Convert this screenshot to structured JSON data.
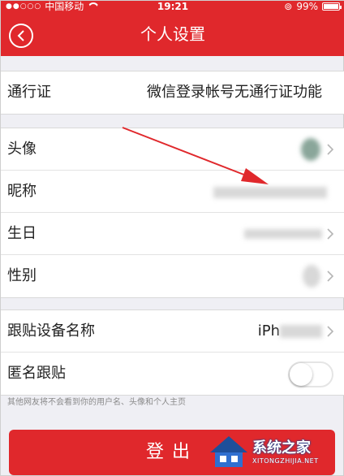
{
  "status_bar": {
    "carrier": "中国移动",
    "time": "19:21",
    "battery": "99%",
    "battery_level": 0.99
  },
  "header": {
    "title": "个人设置",
    "background": "#e0282c"
  },
  "group1": {
    "rows": [
      {
        "label": "通行证",
        "value": "微信登录帐号无通行证功能"
      }
    ]
  },
  "group2": {
    "rows": [
      {
        "label": "头像"
      },
      {
        "label": "昵称"
      },
      {
        "label": "生日"
      },
      {
        "label": "性别"
      }
    ]
  },
  "group3": {
    "rows": [
      {
        "label": "跟贴设备名称",
        "value": "iPh"
      },
      {
        "label": "匿名跟贴",
        "toggle_on": false
      }
    ]
  },
  "note": "其他网友将不会看到你的用户名、头像和个人主页",
  "logout_label": "登出",
  "watermark": {
    "name": "系统之家",
    "url": "XITONGZHIJIA.NET"
  },
  "colors": {
    "accent": "#e0282c",
    "background": "#efeff4"
  }
}
